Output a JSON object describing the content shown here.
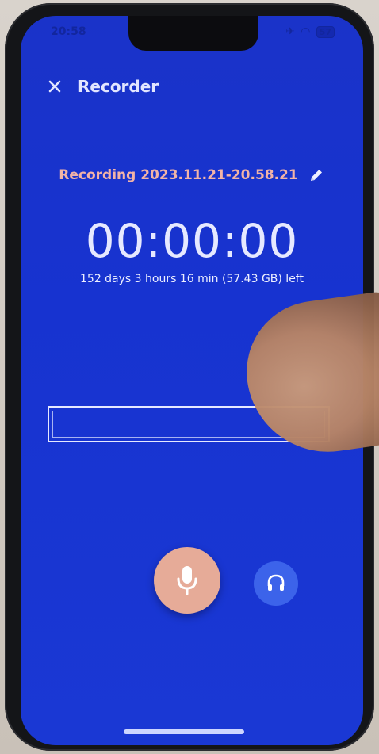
{
  "status_bar": {
    "time": "20:58",
    "battery": "57"
  },
  "header": {
    "title": "Recorder",
    "close_icon": "close-icon"
  },
  "recording": {
    "name": "Recording 2023.11.21-20.58.21",
    "timer": "00:00:00",
    "time_left": "152 days 3 hours 16 min (57.43 GB) left",
    "edit_icon": "pencil-icon"
  },
  "controls": {
    "record_icon": "microphone-icon",
    "monitor_icon": "headphones-icon"
  },
  "colors": {
    "background": "#1a36d0",
    "accent": "#e6ab98",
    "secondary_button": "#3c63ea",
    "recording_name": "#f2b4a7"
  }
}
